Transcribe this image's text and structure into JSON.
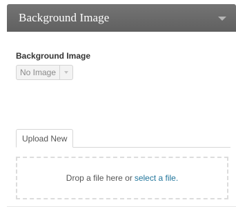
{
  "widget": {
    "title": "Background Image",
    "toggle_icon": "chevron-down-icon"
  },
  "field": {
    "label": "Background Image",
    "select_value": "No Image"
  },
  "uploader": {
    "tab_label": "Upload New",
    "drop_text": "Drop a file here or",
    "select_link": "select a file."
  }
}
